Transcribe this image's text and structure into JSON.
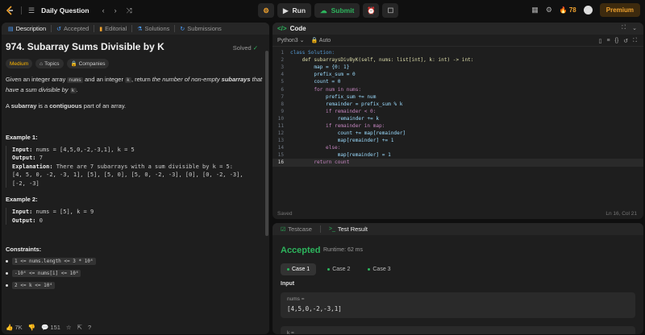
{
  "topbar": {
    "title": "Daily Question",
    "run_label": "Run",
    "submit_label": "Submit",
    "streak": "78",
    "premium_label": "Premium"
  },
  "left_tabs": [
    {
      "label": "Description",
      "icon": "description-icon",
      "active": true
    },
    {
      "label": "Accepted",
      "icon": "history-icon",
      "active": false
    },
    {
      "label": "Editorial",
      "icon": "book-icon",
      "active": false
    },
    {
      "label": "Solutions",
      "icon": "flask-icon",
      "active": false
    },
    {
      "label": "Submissions",
      "icon": "clock-icon",
      "active": false
    }
  ],
  "problem": {
    "title": "974. Subarray Sums Divisible by K",
    "solved_label": "Solved",
    "difficulty": "Medium",
    "topics_label": "Topics",
    "companies_label": "Companies",
    "desc_1a": "Given an integer array ",
    "desc_1_code1": "nums",
    "desc_1b": " and an integer ",
    "desc_1_code2": "k",
    "desc_1c": ", return ",
    "desc_1_em1": "the number of non-empty ",
    "desc_1_strong": "subarrays",
    "desc_1_em2": " that have a sum divisible by ",
    "desc_1_code3": "k",
    "desc_1d": ".",
    "desc_2a": "A ",
    "desc_2_strong1": "subarray",
    "desc_2b": " is a ",
    "desc_2_strong2": "contiguous",
    "desc_2c": " part of an array.",
    "example1_title": "Example 1:",
    "example1_input_label": "Input:",
    "example1_input": " nums = [4,5,0,-2,-3,1], k = 5",
    "example1_output_label": "Output:",
    "example1_output": " 7",
    "example1_expl_label": "Explanation:",
    "example1_expl_1": " There are 7 subarrays with a sum divisible by k = 5:",
    "example1_expl_2": "[4, 5, 0, -2, -3, 1], [5], [5, 0], [5, 0, -2, -3], [0], [0, -2, -3],",
    "example1_expl_3": "[-2, -3]",
    "example2_title": "Example 2:",
    "example2_input_label": "Input:",
    "example2_input": " nums = [5], k = 9",
    "example2_output_label": "Output:",
    "example2_output": " 0",
    "constraints_title": "Constraints:",
    "constraint_1": "1 <= nums.length <= 3 * 10⁴",
    "constraint_2": "-10⁴ <= nums[i] <= 10⁴",
    "constraint_3": "2 <= k <= 10⁴"
  },
  "footer": {
    "likes": "7K",
    "comments": "151"
  },
  "editor": {
    "tab_label": "Code",
    "language": "Python3",
    "auto_label": "Auto",
    "status_left": "Saved",
    "status_right": "Ln 16, Col 21"
  },
  "code_lines": [
    "class Solution:",
    "    def subarraysDivByK(self, nums: list[int], k: int) -> int:",
    "        map = {0: 1}",
    "        prefix_sum = 0",
    "        count = 0",
    "        for num in nums:",
    "            prefix_sum += num",
    "            remainder = prefix_sum % k",
    "            if remainder < 0:",
    "                remainder += k",
    "            if remainder in map:",
    "                count += map[remainder]",
    "                map[remainder] += 1",
    "            else:",
    "                map[remainder] = 1",
    "        return count"
  ],
  "results": {
    "testcase_tab": "Testcase",
    "result_tab": "Test Result",
    "status": "Accepted",
    "runtime": "Runtime: 62 ms",
    "cases": [
      "Case 1",
      "Case 2",
      "Case 3"
    ],
    "input_label": "Input",
    "nums_label": "nums =",
    "nums_value": "[4,5,0,-2,-3,1]",
    "k_label": "k ="
  },
  "colors": {
    "accent_green": "#2db55d",
    "medium": "#ffb800",
    "premium": "#f0a22e"
  }
}
